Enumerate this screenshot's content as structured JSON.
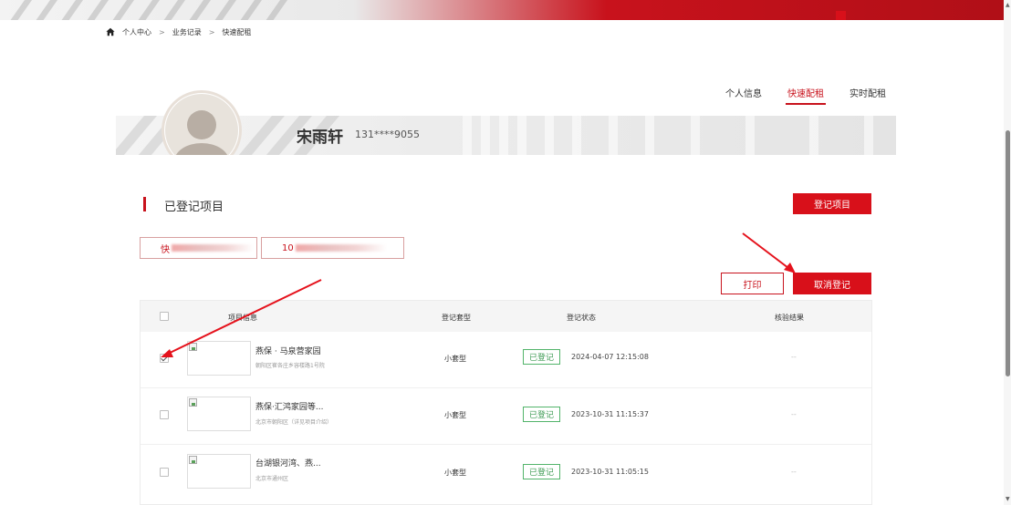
{
  "breadcrumb": {
    "items": [
      "个人中心",
      "业务记录",
      "快速配租"
    ],
    "separator": ">"
  },
  "right_nav": {
    "items": [
      {
        "label": "个人信息",
        "active": false
      },
      {
        "label": "快速配租",
        "active": true
      },
      {
        "label": "实时配租",
        "active": false
      }
    ]
  },
  "profile": {
    "name": "宋雨轩",
    "phone": "131****9055"
  },
  "section": {
    "title": "已登记项目"
  },
  "buttons": {
    "register_project": "登记项目",
    "print": "打印",
    "cancel_register": "取消登记"
  },
  "filters": [
    {
      "label": "快"
    },
    {
      "label": "10"
    }
  ],
  "table": {
    "headers": {
      "project_info": "项目信息",
      "register_type": "登记套型",
      "register_status": "登记状态",
      "verify_result": "核验结果"
    },
    "rows": [
      {
        "checked": true,
        "name": "燕保 · 马泉营家园",
        "address": "朝阳区崔各庄乡容楼路1号院",
        "type": "小套型",
        "status": "已登记",
        "time": "2024-04-07 12:15:08",
        "verify": "--"
      },
      {
        "checked": false,
        "name": "燕保·汇鸿家园等...",
        "address": "北京市朝阳区（详见项目介绍）",
        "type": "小套型",
        "status": "已登记",
        "time": "2023-10-31 11:15:37",
        "verify": "--"
      },
      {
        "checked": false,
        "name": "台湖银河湾、燕...",
        "address": "北京市通州区",
        "type": "小套型",
        "status": "已登记",
        "time": "2023-10-31 11:05:15",
        "verify": "--"
      }
    ]
  },
  "colors": {
    "brand_red": "#d8101a",
    "status_green": "#52b46a"
  }
}
